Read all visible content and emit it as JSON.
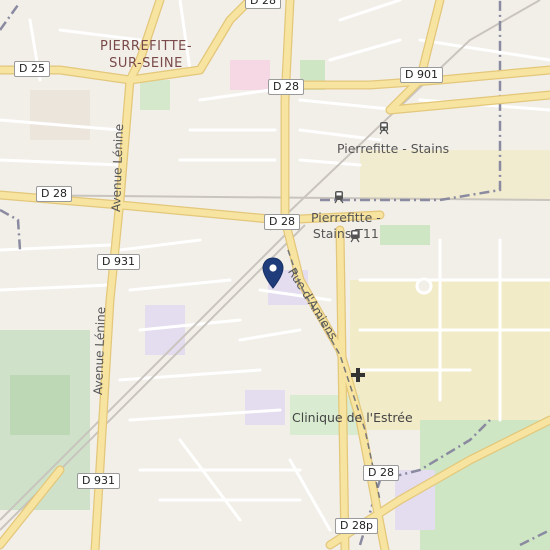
{
  "map": {
    "city": {
      "line1": "PIERREFITTE-",
      "line2": "SUR-SEINE"
    },
    "road_labels": {
      "d25": "D 25",
      "d28_top": "D 28",
      "d28_left": "D 28",
      "d28_center": "D 28",
      "d28_bottom": "D 28",
      "d901": "D 901",
      "d931_top": "D 931",
      "d931_bottom": "D 931",
      "d28p": "D 28p",
      "d28_edge": "D 28"
    },
    "street_labels": {
      "avenue_lenine_top": "Avenue Lénine",
      "avenue_lenine_bottom": "Avenue Lénine",
      "rue_damiens": "Rue d'Amiens"
    },
    "stations": {
      "pierrefitte_stains": "Pierrefitte - Stains",
      "pierrefitte_stains_t11_line1": "Pierrefitte -",
      "pierrefitte_stains_t11_line2": "Stains T11"
    },
    "poi": {
      "clinique": "Clinique de l'Estrée"
    },
    "icons": {
      "marker": "map-pin-icon",
      "hospital": "hospital-cross-icon",
      "train": "train-station-icon"
    },
    "colors": {
      "major_road": "#f7e4a0",
      "major_road_edge": "#e3c77a",
      "marker": "#1f3d7a",
      "boundary": "#8a8aa0",
      "park": "#cfe6c4",
      "industrial": "#efe6b4"
    }
  }
}
